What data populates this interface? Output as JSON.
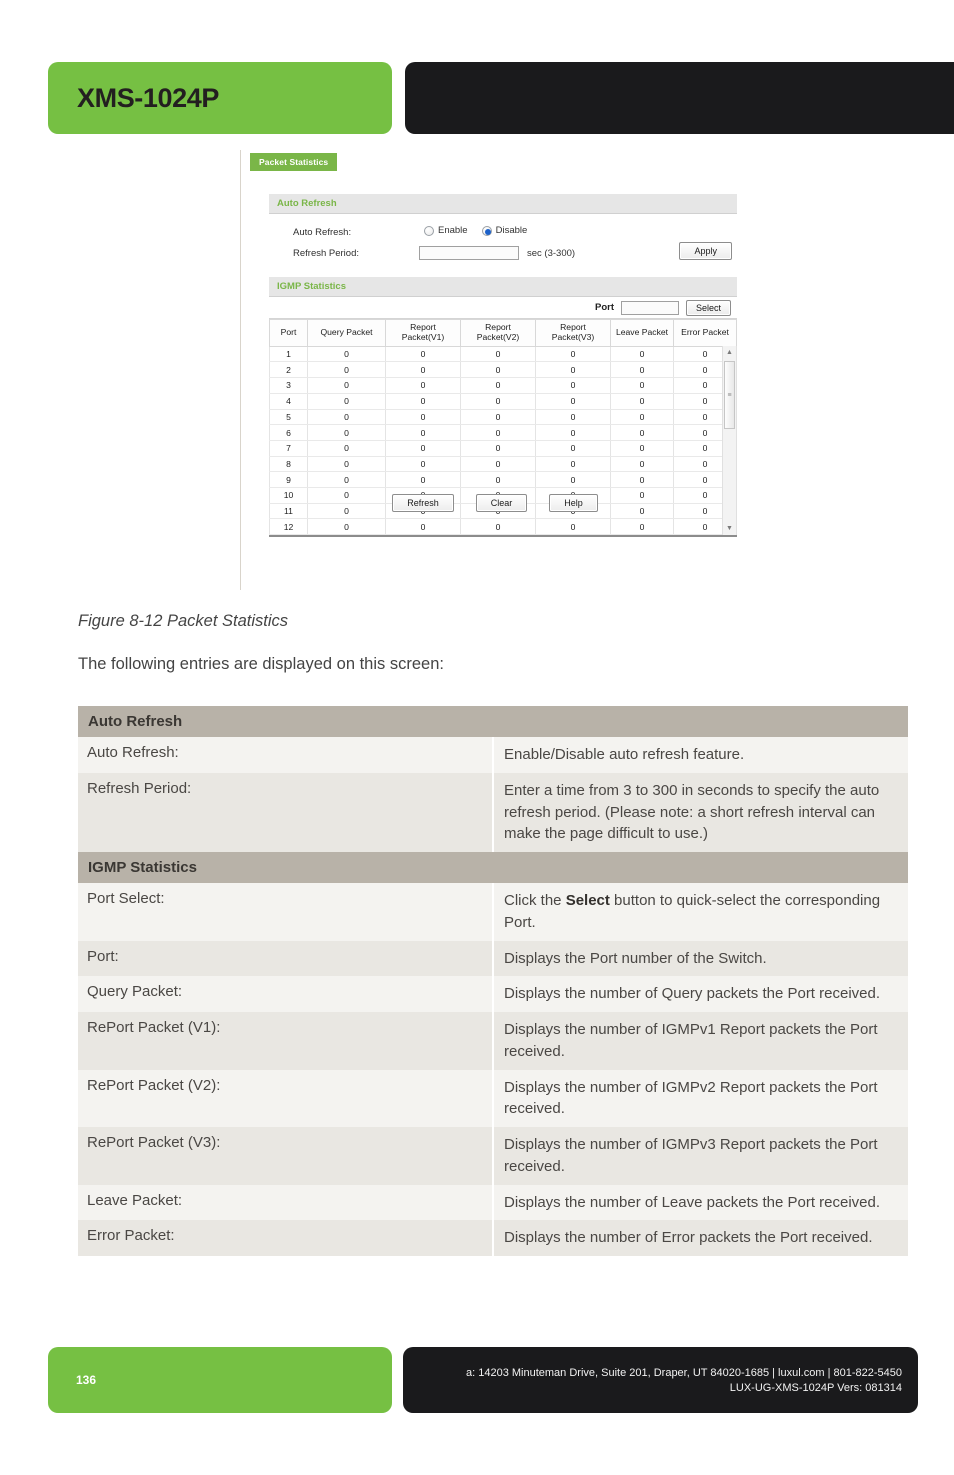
{
  "header": {
    "model": "XMS-1024P"
  },
  "figure": {
    "tab_label": "Packet Statistics",
    "auto_refresh_panel": {
      "title": "Auto Refresh",
      "auto_refresh_label": "Auto Refresh:",
      "enable_label": "Enable",
      "disable_label": "Disable",
      "selected_option": "Disable",
      "refresh_period_label": "Refresh Period:",
      "refresh_period_value": "",
      "refresh_period_hint": "sec (3-300)",
      "apply_label": "Apply"
    },
    "igmp_panel": {
      "title": "IGMP Statistics",
      "port_label": "Port",
      "port_value": "",
      "select_label": "Select",
      "columns": [
        "Port",
        "Query Packet",
        "Report Packet(V1)",
        "Report Packet(V2)",
        "Report Packet(V3)",
        "Leave Packet",
        "Error Packet"
      ],
      "rows": [
        [
          "1",
          "0",
          "0",
          "0",
          "0",
          "0",
          "0"
        ],
        [
          "2",
          "0",
          "0",
          "0",
          "0",
          "0",
          "0"
        ],
        [
          "3",
          "0",
          "0",
          "0",
          "0",
          "0",
          "0"
        ],
        [
          "4",
          "0",
          "0",
          "0",
          "0",
          "0",
          "0"
        ],
        [
          "5",
          "0",
          "0",
          "0",
          "0",
          "0",
          "0"
        ],
        [
          "6",
          "0",
          "0",
          "0",
          "0",
          "0",
          "0"
        ],
        [
          "7",
          "0",
          "0",
          "0",
          "0",
          "0",
          "0"
        ],
        [
          "8",
          "0",
          "0",
          "0",
          "0",
          "0",
          "0"
        ],
        [
          "9",
          "0",
          "0",
          "0",
          "0",
          "0",
          "0"
        ],
        [
          "10",
          "0",
          "0",
          "0",
          "0",
          "0",
          "0"
        ],
        [
          "11",
          "0",
          "0",
          "0",
          "0",
          "0",
          "0"
        ],
        [
          "12",
          "0",
          "0",
          "0",
          "0",
          "0",
          "0"
        ]
      ]
    },
    "buttons": {
      "refresh": "Refresh",
      "clear": "Clear",
      "help": "Help"
    }
  },
  "caption": "Figure 8-12 Packet Statistics",
  "intro": "The following entries are displayed on this screen:",
  "desc_table": [
    {
      "type": "section",
      "label": "Auto Refresh"
    },
    {
      "type": "row",
      "key": "Auto Refresh:",
      "value": "Enable/Disable auto refresh feature."
    },
    {
      "type": "row",
      "key": "Refresh Period:",
      "value": "Enter a time from 3 to 300 in seconds to specify the auto refresh period. (Please note: a short refresh interval can make the page difficult to use.)"
    },
    {
      "type": "section",
      "label": "IGMP Statistics"
    },
    {
      "type": "row",
      "key": "Port Select:",
      "value_pre": "Click the ",
      "value_bold": "Select",
      "value_post": " button to quick-select the corresponding Port."
    },
    {
      "type": "row",
      "key": "Port:",
      "value": "Displays the Port number of the Switch."
    },
    {
      "type": "row",
      "key": "Query Packet:",
      "value": "Displays the number of Query packets the Port received."
    },
    {
      "type": "row",
      "key": "RePort Packet (V1):",
      "value": "Displays the number of IGMPv1 Report packets the Port received."
    },
    {
      "type": "row",
      "key": "RePort Packet (V2):",
      "value": "Displays the number of IGMPv2 Report packets the Port received."
    },
    {
      "type": "row",
      "key": "RePort Packet (V3):",
      "value": "Displays the number of IGMPv3 Report packets the Port received."
    },
    {
      "type": "row",
      "key": "Leave Packet:",
      "value": "Displays the number of Leave packets the Port received."
    },
    {
      "type": "row",
      "key": "Error Packet:",
      "value": "Displays the number of Error packets the Port received."
    }
  ],
  "footer": {
    "page_number": "136",
    "address_line": "a: 14203 Minuteman Drive, Suite 201, Draper, UT 84020-1685 | luxul.com | 801-822-5450",
    "doc_line": "LUX-UG-XMS-1024P  Vers: 081314"
  },
  "colors": {
    "brand_green": "#76C043",
    "header_black": "#1a1a1c",
    "section_gray": "#b8b2a8",
    "row_light": "#f4f3f0",
    "row_dark": "#e9e7e2",
    "ui_tab_green": "#7ab648",
    "radio_blue": "#1c61c9"
  }
}
